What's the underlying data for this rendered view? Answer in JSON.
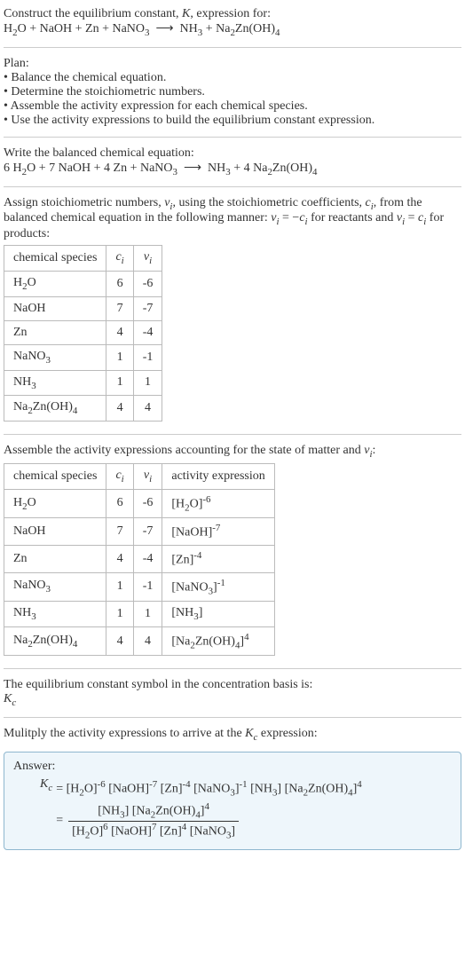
{
  "header": {
    "line1": "Construct the equilibrium constant, K, expression for:",
    "equation": "H₂O + NaOH + Zn + NaNO₃ ⟶ NH₃ + Na₂Zn(OH)₄"
  },
  "plan": {
    "title": "Plan:",
    "items": [
      "• Balance the chemical equation.",
      "• Determine the stoichiometric numbers.",
      "• Assemble the activity expression for each chemical species.",
      "• Use the activity expressions to build the equilibrium constant expression."
    ]
  },
  "balanced": {
    "title": "Write the balanced chemical equation:",
    "equation": "6 H₂O + 7 NaOH + 4 Zn + NaNO₃ ⟶ NH₃ + 4 Na₂Zn(OH)₄"
  },
  "stoich": {
    "intro": "Assign stoichiometric numbers, νᵢ, using the stoichiometric coefficients, cᵢ, from the balanced chemical equation in the following manner: νᵢ = −cᵢ for reactants and νᵢ = cᵢ for products:",
    "headers": {
      "species": "chemical species",
      "ci": "cᵢ",
      "vi": "νᵢ"
    },
    "rows": [
      {
        "species": "H₂O",
        "ci": "6",
        "vi": "-6"
      },
      {
        "species": "NaOH",
        "ci": "7",
        "vi": "-7"
      },
      {
        "species": "Zn",
        "ci": "4",
        "vi": "-4"
      },
      {
        "species": "NaNO₃",
        "ci": "1",
        "vi": "-1"
      },
      {
        "species": "NH₃",
        "ci": "1",
        "vi": "1"
      },
      {
        "species": "Na₂Zn(OH)₄",
        "ci": "4",
        "vi": "4"
      }
    ]
  },
  "activity": {
    "intro": "Assemble the activity expressions accounting for the state of matter and νᵢ:",
    "headers": {
      "species": "chemical species",
      "ci": "cᵢ",
      "vi": "νᵢ",
      "act": "activity expression"
    },
    "rows": [
      {
        "species": "H₂O",
        "ci": "6",
        "vi": "-6",
        "act": "[H₂O]⁻⁶"
      },
      {
        "species": "NaOH",
        "ci": "7",
        "vi": "-7",
        "act": "[NaOH]⁻⁷"
      },
      {
        "species": "Zn",
        "ci": "4",
        "vi": "-4",
        "act": "[Zn]⁻⁴"
      },
      {
        "species": "NaNO₃",
        "ci": "1",
        "vi": "-1",
        "act": "[NaNO₃]⁻¹"
      },
      {
        "species": "NH₃",
        "ci": "1",
        "vi": "1",
        "act": "[NH₃]"
      },
      {
        "species": "Na₂Zn(OH)₄",
        "ci": "4",
        "vi": "4",
        "act": "[Na₂Zn(OH)₄]⁴"
      }
    ]
  },
  "kc_symbol": {
    "line1": "The equilibrium constant symbol in the concentration basis is:",
    "line2": "K_c"
  },
  "multiply": {
    "line": "Mulitply the activity expressions to arrive at the K_c expression:"
  },
  "answer": {
    "label": "Answer:",
    "lhs": "K_c",
    "product_line": "= [H₂O]⁻⁶ [NaOH]⁻⁷ [Zn]⁻⁴ [NaNO₃]⁻¹ [NH₃] [Na₂Zn(OH)₄]⁴",
    "frac_eq": "=",
    "frac_num": "[NH₃] [Na₂Zn(OH)₄]⁴",
    "frac_den": "[H₂O]⁶ [NaOH]⁷ [Zn]⁴ [NaNO₃]"
  },
  "chart_data": {
    "type": "table",
    "tables": [
      {
        "title": "Stoichiometric numbers",
        "columns": [
          "chemical species",
          "cᵢ",
          "νᵢ"
        ],
        "rows": [
          [
            "H₂O",
            6,
            -6
          ],
          [
            "NaOH",
            7,
            -7
          ],
          [
            "Zn",
            4,
            -4
          ],
          [
            "NaNO₃",
            1,
            -1
          ],
          [
            "NH₃",
            1,
            1
          ],
          [
            "Na₂Zn(OH)₄",
            4,
            4
          ]
        ]
      },
      {
        "title": "Activity expressions",
        "columns": [
          "chemical species",
          "cᵢ",
          "νᵢ",
          "activity expression"
        ],
        "rows": [
          [
            "H₂O",
            6,
            -6,
            "[H₂O]^-6"
          ],
          [
            "NaOH",
            7,
            -7,
            "[NaOH]^-7"
          ],
          [
            "Zn",
            4,
            -4,
            "[Zn]^-4"
          ],
          [
            "NaNO₃",
            1,
            -1,
            "[NaNO₃]^-1"
          ],
          [
            "NH₃",
            1,
            1,
            "[NH₃]"
          ],
          [
            "Na₂Zn(OH)₄",
            4,
            4,
            "[Na₂Zn(OH)₄]^4"
          ]
        ]
      }
    ]
  }
}
